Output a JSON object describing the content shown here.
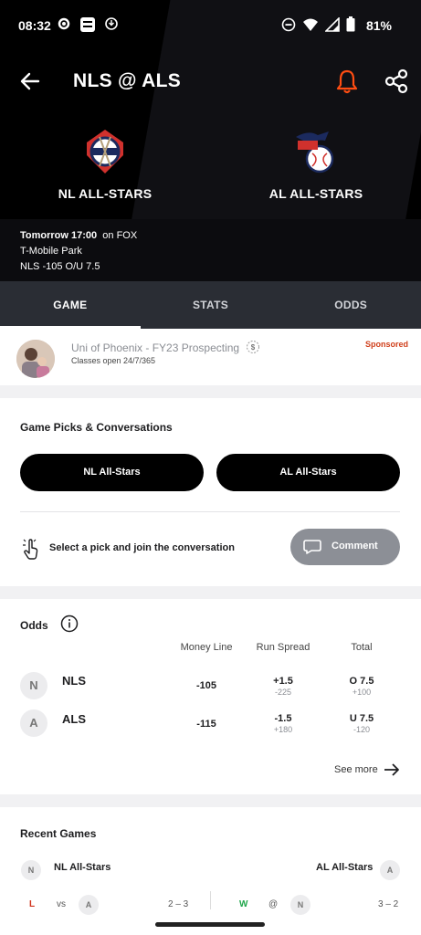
{
  "status_bar": {
    "time": "08:32",
    "battery": "81%"
  },
  "header": {
    "title": "NLS @ ALS"
  },
  "teams": {
    "home": {
      "name": "NL ALL-STARS"
    },
    "away": {
      "name": "AL ALL-STARS"
    }
  },
  "game_info": {
    "time": "Tomorrow 17:00",
    "network": "on FOX",
    "venue": "T-Mobile Park",
    "line": "NLS -105 O/U 7.5"
  },
  "tabs": [
    {
      "label": "GAME",
      "active": true
    },
    {
      "label": "STATS",
      "active": false
    },
    {
      "label": "ODDS",
      "active": false
    }
  ],
  "ad": {
    "title": "Uni of Phoenix - FY23 Prospecting",
    "subtitle": "Classes open 24/7/365",
    "sponsored": "Sponsored"
  },
  "picks": {
    "title": "Game Picks & Conversations",
    "left_pick": "NL All-Stars",
    "right_pick": "AL All-Stars",
    "prompt": "Select a pick and join the conversation",
    "comment_label": "Comment"
  },
  "odds": {
    "title": "Odds",
    "headers": {
      "money_line": "Money Line",
      "run_spread": "Run Spread",
      "total": "Total"
    },
    "rows": [
      {
        "initial": "N",
        "team": "NLS",
        "money_line": "-105",
        "spread": "+1.5",
        "spread_odds": "-225",
        "total": "O 7.5",
        "total_odds": "+100"
      },
      {
        "initial": "A",
        "team": "ALS",
        "money_line": "-115",
        "spread": "-1.5",
        "spread_odds": "+180",
        "total": "U 7.5",
        "total_odds": "-120"
      }
    ],
    "see_more": "See more"
  },
  "recent_games": {
    "title": "Recent Games",
    "left_team": {
      "initial": "N",
      "name": "NL All-Stars"
    },
    "right_team": {
      "initial": "A",
      "name": "AL All-Stars"
    },
    "left_result": {
      "result": "L",
      "vs": "vs",
      "opp_initial": "A",
      "score": "2 – 3"
    },
    "right_result": {
      "result": "W",
      "vs": "@",
      "opp_initial": "N",
      "score": "3 – 2"
    }
  },
  "colors": {
    "accent": "#ff4d12",
    "win": "#1fa64a",
    "loss": "#d0321c"
  }
}
